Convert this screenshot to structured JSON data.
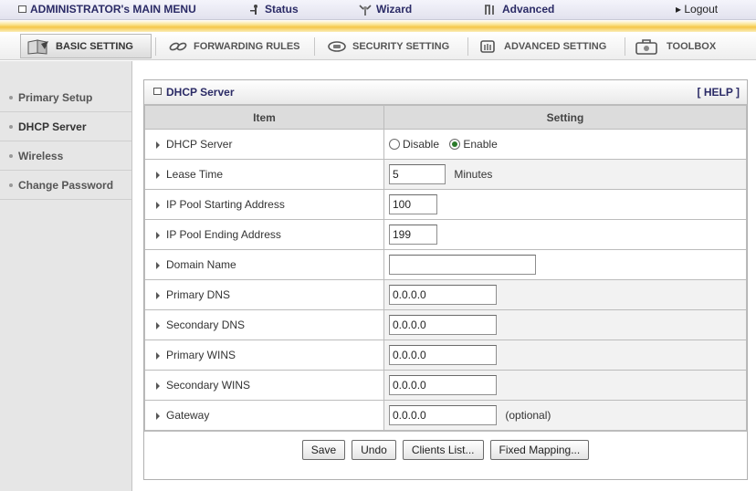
{
  "topbar": {
    "main_menu": "ADMINISTRATOR's MAIN MENU",
    "status": "Status",
    "wizard": "Wizard",
    "advanced": "Advanced",
    "logout": "Logout",
    "logout_prefix": "▸"
  },
  "tabs": [
    {
      "label": "BASIC SETTING",
      "active": true
    },
    {
      "label": "FORWARDING RULES",
      "active": false
    },
    {
      "label": "SECURITY SETTING",
      "active": false
    },
    {
      "label": "ADVANCED SETTING",
      "active": false
    },
    {
      "label": "TOOLBOX",
      "active": false
    }
  ],
  "sidebar": {
    "items": [
      {
        "label": "Primary Setup"
      },
      {
        "label": "DHCP Server"
      },
      {
        "label": "Wireless"
      },
      {
        "label": "Change Password"
      }
    ]
  },
  "panel": {
    "title": "DHCP Server",
    "help": "[ HELP ]",
    "col_item": "Item",
    "col_setting": "Setting"
  },
  "form": {
    "dhcp_server": {
      "label": "DHCP Server",
      "opt_disable": "Disable",
      "opt_enable": "Enable",
      "selected": "Enable"
    },
    "lease_time": {
      "label": "Lease Time",
      "value": "5",
      "suffix": "Minutes"
    },
    "pool_start": {
      "label": "IP Pool Starting Address",
      "value": "100"
    },
    "pool_end": {
      "label": "IP Pool Ending Address",
      "value": "199"
    },
    "domain_name": {
      "label": "Domain Name",
      "value": ""
    },
    "primary_dns": {
      "label": "Primary DNS",
      "value": "0.0.0.0"
    },
    "secondary_dns": {
      "label": "Secondary DNS",
      "value": "0.0.0.0"
    },
    "primary_wins": {
      "label": "Primary WINS",
      "value": "0.0.0.0"
    },
    "secondary_wins": {
      "label": "Secondary WINS",
      "value": "0.0.0.0"
    },
    "gateway": {
      "label": "Gateway",
      "value": "0.0.0.0",
      "suffix": "(optional)"
    }
  },
  "buttons": {
    "save": "Save",
    "undo": "Undo",
    "clients": "Clients List...",
    "fixed": "Fixed Mapping..."
  },
  "colors": {
    "accent_text": "#2b2b66",
    "stripe_yellow": "#f5c74a",
    "sidebar_bg": "#e6e6e6"
  },
  "icons": {
    "main_menu": "square-icon",
    "status": "person-icon",
    "wizard": "wand-icon",
    "advanced": "tool-icon",
    "basic": "book-icon",
    "forwarding": "link-icon",
    "security": "lock-icon",
    "advanced_setting": "gear-icon",
    "toolbox": "toolbox-icon"
  }
}
